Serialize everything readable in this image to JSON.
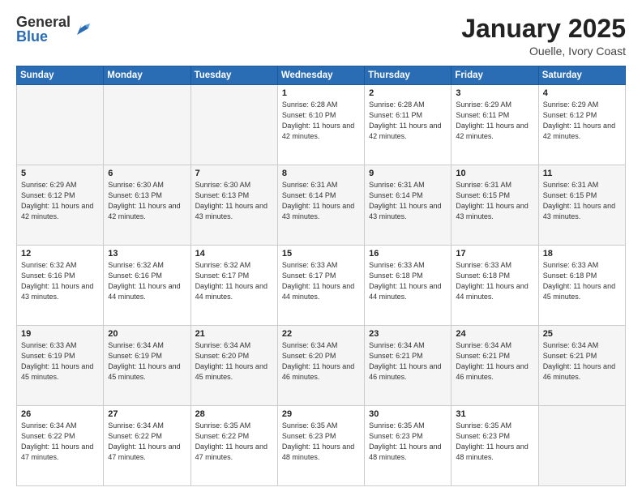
{
  "header": {
    "logo_general": "General",
    "logo_blue": "Blue",
    "title": "January 2025",
    "location": "Ouelle, Ivory Coast"
  },
  "days_of_week": [
    "Sunday",
    "Monday",
    "Tuesday",
    "Wednesday",
    "Thursday",
    "Friday",
    "Saturday"
  ],
  "weeks": [
    [
      {
        "day": "",
        "info": ""
      },
      {
        "day": "",
        "info": ""
      },
      {
        "day": "",
        "info": ""
      },
      {
        "day": "1",
        "info": "Sunrise: 6:28 AM\nSunset: 6:10 PM\nDaylight: 11 hours and 42 minutes."
      },
      {
        "day": "2",
        "info": "Sunrise: 6:28 AM\nSunset: 6:11 PM\nDaylight: 11 hours and 42 minutes."
      },
      {
        "day": "3",
        "info": "Sunrise: 6:29 AM\nSunset: 6:11 PM\nDaylight: 11 hours and 42 minutes."
      },
      {
        "day": "4",
        "info": "Sunrise: 6:29 AM\nSunset: 6:12 PM\nDaylight: 11 hours and 42 minutes."
      }
    ],
    [
      {
        "day": "5",
        "info": "Sunrise: 6:29 AM\nSunset: 6:12 PM\nDaylight: 11 hours and 42 minutes."
      },
      {
        "day": "6",
        "info": "Sunrise: 6:30 AM\nSunset: 6:13 PM\nDaylight: 11 hours and 42 minutes."
      },
      {
        "day": "7",
        "info": "Sunrise: 6:30 AM\nSunset: 6:13 PM\nDaylight: 11 hours and 43 minutes."
      },
      {
        "day": "8",
        "info": "Sunrise: 6:31 AM\nSunset: 6:14 PM\nDaylight: 11 hours and 43 minutes."
      },
      {
        "day": "9",
        "info": "Sunrise: 6:31 AM\nSunset: 6:14 PM\nDaylight: 11 hours and 43 minutes."
      },
      {
        "day": "10",
        "info": "Sunrise: 6:31 AM\nSunset: 6:15 PM\nDaylight: 11 hours and 43 minutes."
      },
      {
        "day": "11",
        "info": "Sunrise: 6:31 AM\nSunset: 6:15 PM\nDaylight: 11 hours and 43 minutes."
      }
    ],
    [
      {
        "day": "12",
        "info": "Sunrise: 6:32 AM\nSunset: 6:16 PM\nDaylight: 11 hours and 43 minutes."
      },
      {
        "day": "13",
        "info": "Sunrise: 6:32 AM\nSunset: 6:16 PM\nDaylight: 11 hours and 44 minutes."
      },
      {
        "day": "14",
        "info": "Sunrise: 6:32 AM\nSunset: 6:17 PM\nDaylight: 11 hours and 44 minutes."
      },
      {
        "day": "15",
        "info": "Sunrise: 6:33 AM\nSunset: 6:17 PM\nDaylight: 11 hours and 44 minutes."
      },
      {
        "day": "16",
        "info": "Sunrise: 6:33 AM\nSunset: 6:18 PM\nDaylight: 11 hours and 44 minutes."
      },
      {
        "day": "17",
        "info": "Sunrise: 6:33 AM\nSunset: 6:18 PM\nDaylight: 11 hours and 44 minutes."
      },
      {
        "day": "18",
        "info": "Sunrise: 6:33 AM\nSunset: 6:18 PM\nDaylight: 11 hours and 45 minutes."
      }
    ],
    [
      {
        "day": "19",
        "info": "Sunrise: 6:33 AM\nSunset: 6:19 PM\nDaylight: 11 hours and 45 minutes."
      },
      {
        "day": "20",
        "info": "Sunrise: 6:34 AM\nSunset: 6:19 PM\nDaylight: 11 hours and 45 minutes."
      },
      {
        "day": "21",
        "info": "Sunrise: 6:34 AM\nSunset: 6:20 PM\nDaylight: 11 hours and 45 minutes."
      },
      {
        "day": "22",
        "info": "Sunrise: 6:34 AM\nSunset: 6:20 PM\nDaylight: 11 hours and 46 minutes."
      },
      {
        "day": "23",
        "info": "Sunrise: 6:34 AM\nSunset: 6:21 PM\nDaylight: 11 hours and 46 minutes."
      },
      {
        "day": "24",
        "info": "Sunrise: 6:34 AM\nSunset: 6:21 PM\nDaylight: 11 hours and 46 minutes."
      },
      {
        "day": "25",
        "info": "Sunrise: 6:34 AM\nSunset: 6:21 PM\nDaylight: 11 hours and 46 minutes."
      }
    ],
    [
      {
        "day": "26",
        "info": "Sunrise: 6:34 AM\nSunset: 6:22 PM\nDaylight: 11 hours and 47 minutes."
      },
      {
        "day": "27",
        "info": "Sunrise: 6:34 AM\nSunset: 6:22 PM\nDaylight: 11 hours and 47 minutes."
      },
      {
        "day": "28",
        "info": "Sunrise: 6:35 AM\nSunset: 6:22 PM\nDaylight: 11 hours and 47 minutes."
      },
      {
        "day": "29",
        "info": "Sunrise: 6:35 AM\nSunset: 6:23 PM\nDaylight: 11 hours and 48 minutes."
      },
      {
        "day": "30",
        "info": "Sunrise: 6:35 AM\nSunset: 6:23 PM\nDaylight: 11 hours and 48 minutes."
      },
      {
        "day": "31",
        "info": "Sunrise: 6:35 AM\nSunset: 6:23 PM\nDaylight: 11 hours and 48 minutes."
      },
      {
        "day": "",
        "info": ""
      }
    ]
  ]
}
